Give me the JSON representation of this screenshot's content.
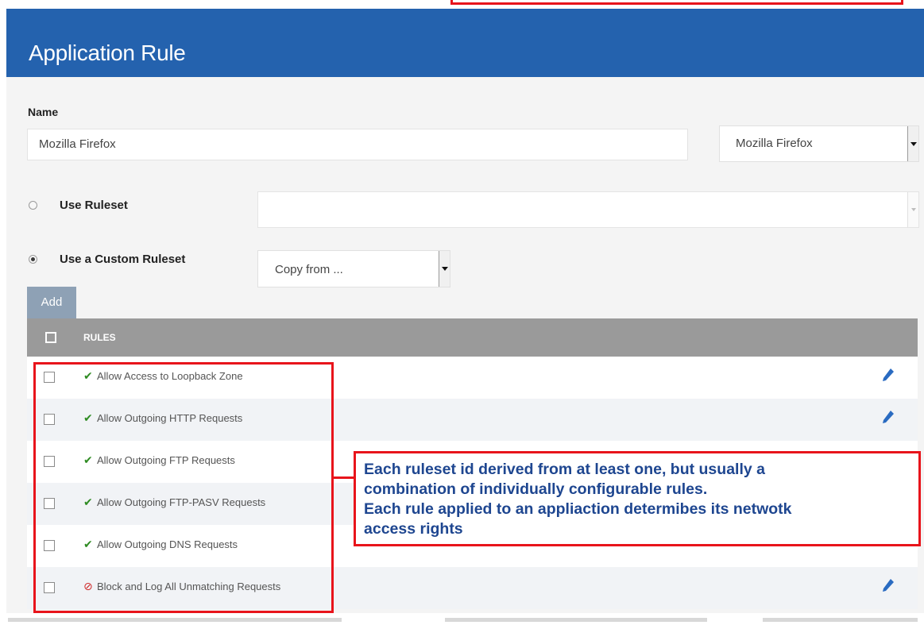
{
  "header": {
    "title": "Application Rule"
  },
  "form": {
    "name_label": "Name",
    "name_value": "Mozilla Firefox",
    "app_select_value": "Mozilla Firefox",
    "use_ruleset_label": "Use Ruleset",
    "use_ruleset_checked": false,
    "ruleset_select_value": "",
    "use_custom_label": "Use a Custom Ruleset",
    "use_custom_checked": true,
    "copy_from_value": "Copy from ..."
  },
  "toolbar": {
    "add_label": "Add"
  },
  "rules": {
    "header": "RULES",
    "items": [
      {
        "icon": "allow-check-icon",
        "label": "Allow Access to Loopback Zone",
        "editable": true
      },
      {
        "icon": "allow-check-icon",
        "label": "Allow Outgoing HTTP Requests",
        "editable": true
      },
      {
        "icon": "allow-check-icon",
        "label": "Allow Outgoing FTP Requests",
        "editable": false
      },
      {
        "icon": "allow-check-icon",
        "label": "Allow Outgoing FTP-PASV Requests",
        "editable": false
      },
      {
        "icon": "allow-check-icon",
        "label": "Allow Outgoing DNS Requests",
        "editable": false
      },
      {
        "icon": "block-icon",
        "label": "Block and Log All Unmatching Requests",
        "editable": true
      }
    ]
  },
  "annotation": {
    "lines": [
      "Each ruleset id derived from at least one, but usually a",
      "combination of individually configurable rules.",
      "Each rule applied to an appliaction determibes its netwotk",
      "access rights"
    ]
  },
  "colors": {
    "header_bg": "#2462ae",
    "annotation_border": "#e8141b",
    "annotation_text": "#1e4690",
    "allow_green": "#2e8b22",
    "block_red": "#cf2b2b",
    "edit_blue": "#2a6bc1"
  }
}
